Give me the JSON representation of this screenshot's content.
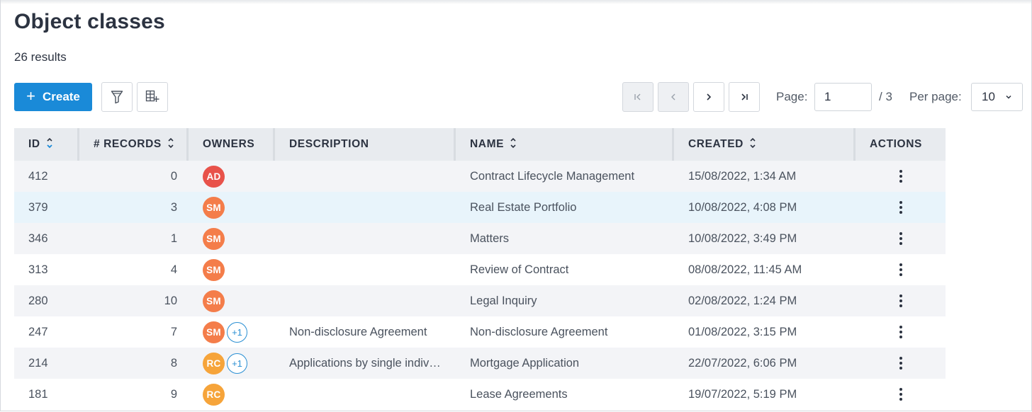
{
  "page": {
    "title": "Object classes",
    "results": "26 results"
  },
  "toolbar": {
    "create_label": "Create",
    "create_icon": "plus-icon",
    "filter_icon": "filter-icon",
    "columns_icon": "table-add-column-icon"
  },
  "pagination": {
    "page_label": "Page:",
    "current_page": "1",
    "total": "/ 3",
    "per_page_label": "Per page:",
    "per_page_value": "10"
  },
  "table": {
    "columns": [
      "ID",
      "# RECORDS",
      "OWNERS",
      "DESCRIPTION",
      "NAME",
      "CREATED",
      "ACTIONS"
    ],
    "rows": [
      {
        "id": "412",
        "records": "0",
        "owner": "AD",
        "owner_color": "#e8524a",
        "extra": "",
        "description": "",
        "name": "Contract Lifecycle Management",
        "created": "15/08/2022, 1:34 AM"
      },
      {
        "id": "379",
        "records": "3",
        "owner": "SM",
        "owner_color": "#f47d4a",
        "extra": "",
        "description": "",
        "name": "Real Estate Portfolio",
        "created": "10/08/2022, 4:08 PM"
      },
      {
        "id": "346",
        "records": "1",
        "owner": "SM",
        "owner_color": "#f47d4a",
        "extra": "",
        "description": "",
        "name": "Matters",
        "created": "10/08/2022, 3:49 PM"
      },
      {
        "id": "313",
        "records": "4",
        "owner": "SM",
        "owner_color": "#f47d4a",
        "extra": "",
        "description": "",
        "name": "Review of Contract",
        "created": "08/08/2022, 11:45 AM"
      },
      {
        "id": "280",
        "records": "10",
        "owner": "SM",
        "owner_color": "#f47d4a",
        "extra": "",
        "description": "",
        "name": "Legal Inquiry",
        "created": "02/08/2022, 1:24 PM"
      },
      {
        "id": "247",
        "records": "7",
        "owner": "SM",
        "owner_color": "#f47d4a",
        "extra": "+1",
        "description": "Non-disclosure Agreement",
        "name": "Non-disclosure Agreement",
        "created": "01/08/2022, 3:15 PM"
      },
      {
        "id": "214",
        "records": "8",
        "owner": "RC",
        "owner_color": "#f6a43a",
        "extra": "+1",
        "description": "Applications by single indiv…",
        "name": "Mortgage Application",
        "created": "22/07/2022, 6:06 PM"
      },
      {
        "id": "181",
        "records": "9",
        "owner": "RC",
        "owner_color": "#f6a43a",
        "extra": "",
        "description": "",
        "name": "Lease Agreements",
        "created": "19/07/2022, 5:19 PM"
      }
    ]
  },
  "colors": {
    "accent": "#1a8ad8",
    "header_bg": "#e8ebef",
    "row_alt_bg": "#f3f4f7",
    "row_hover_bg": "#e8f4fb"
  }
}
